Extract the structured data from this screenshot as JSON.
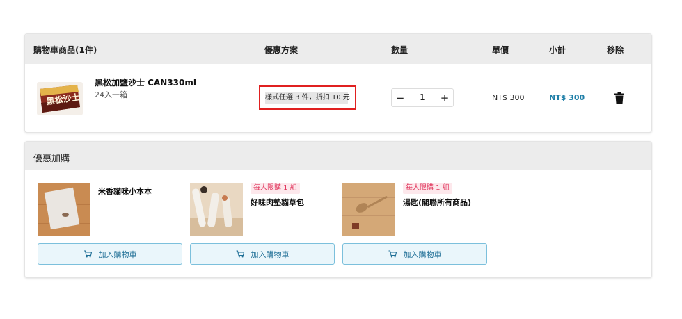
{
  "cart": {
    "headers": {
      "product": "購物車商品(1件)",
      "promo": "優惠方案",
      "qty": "數量",
      "price": "單價",
      "subtotal": "小計",
      "remove": "移除"
    },
    "item": {
      "name": "黑松加鹽沙士 CAN330ml",
      "spec": "24入一箱",
      "promo": "樣式任選 3 件，折扣 10 元",
      "quantity": "1",
      "minus": "−",
      "plus": "+",
      "price": "NT$ 300",
      "subtotal": "NT$ 300"
    }
  },
  "addon": {
    "title": "優惠加購",
    "items": [
      {
        "name": "米香貓咪小本本",
        "limit": "",
        "button": "加入購物車"
      },
      {
        "name": "好味肉墊貓草包",
        "limit": "每人限購 1 組",
        "button": "加入購物車"
      },
      {
        "name": "湯匙(關聯所有商品)",
        "limit": "每人限購 1 組",
        "button": "加入購物車"
      }
    ]
  },
  "colors": {
    "accent": "#1f7fa8",
    "highlight_border": "#e02020",
    "limit_text": "#e0335a",
    "button_bg": "#eaf6fb"
  },
  "icons": {
    "trash": "trash-icon",
    "cart": "cart-icon"
  }
}
